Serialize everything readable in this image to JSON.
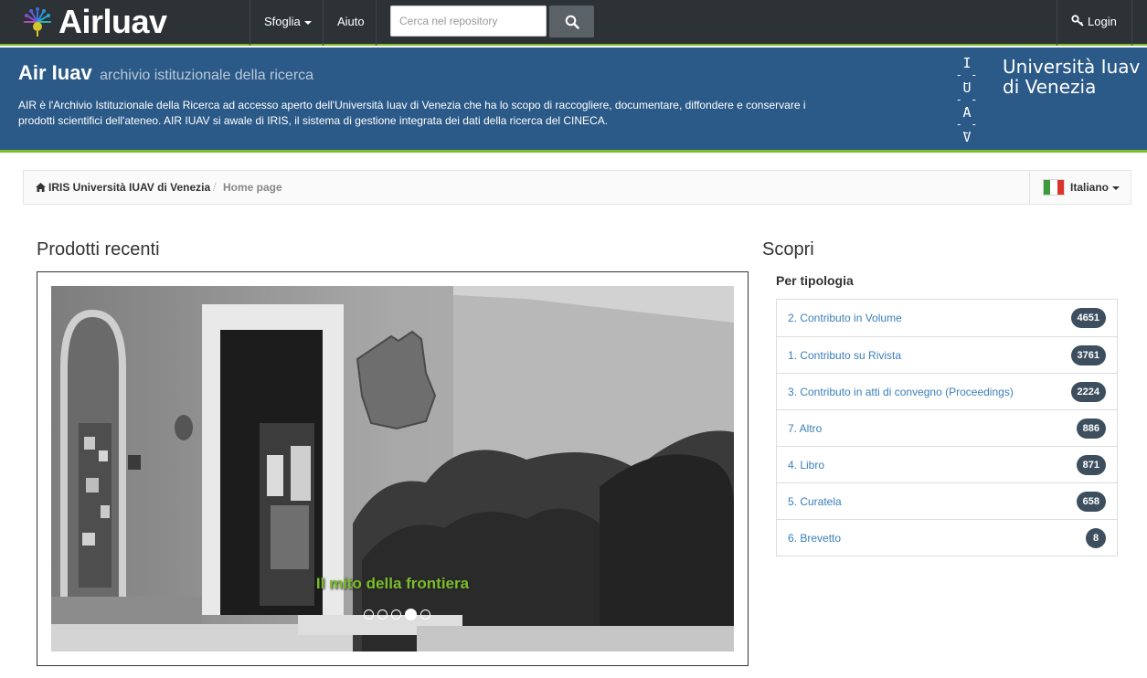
{
  "navbar": {
    "brand": "Airluav",
    "menu": [
      {
        "label": "Sfoglia",
        "has_caret": true
      },
      {
        "label": "Aiuto",
        "has_caret": false
      }
    ],
    "search": {
      "placeholder": "Cerca nel repository",
      "value": ""
    },
    "login_label": "Login",
    "accent_color": "#7bbd2a"
  },
  "banner": {
    "title": "Air Iuav",
    "subtitle": "archivio istituzionale della ricerca",
    "description": "AIR è l'Archivio Istituzionale della Ricerca ad accesso aperto dell'Università Iuav di Venezia che ha lo scopo di raccogliere, documentare, diffondere e conservare i prodotti scientifici dell'ateneo. AIR IUAV si awale di IRIS, il sistema di gestione integrata dei dati della ricerca del CINECA.",
    "university": {
      "letters": [
        "I",
        "U",
        "A",
        "V"
      ],
      "name_line1": "Università Iuav",
      "name_line2": "di Venezia"
    },
    "background_color": "#2b5a88"
  },
  "breadcrumb": {
    "home": "IRIS Università IUAV di Venezia",
    "separator": "/",
    "current": "Home page",
    "language": "Italiano"
  },
  "recent": {
    "title": "Prodotti recenti",
    "slide_caption": "Il mito della frontiera",
    "slide_count": 5,
    "active_slide": 3
  },
  "discover": {
    "title": "Scopri",
    "facet_title": "Per tipologia",
    "items": [
      {
        "label": "2. Contributo in Volume",
        "count": "4651"
      },
      {
        "label": "1. Contributo su Rivista",
        "count": "3761"
      },
      {
        "label": "3. Contributo in atti di convegno (Proceedings)",
        "count": "2224"
      },
      {
        "label": "7. Altro",
        "count": "886"
      },
      {
        "label": "4. Libro",
        "count": "871"
      },
      {
        "label": "5. Curatela",
        "count": "658"
      },
      {
        "label": "6. Brevetto",
        "count": "8"
      }
    ]
  }
}
